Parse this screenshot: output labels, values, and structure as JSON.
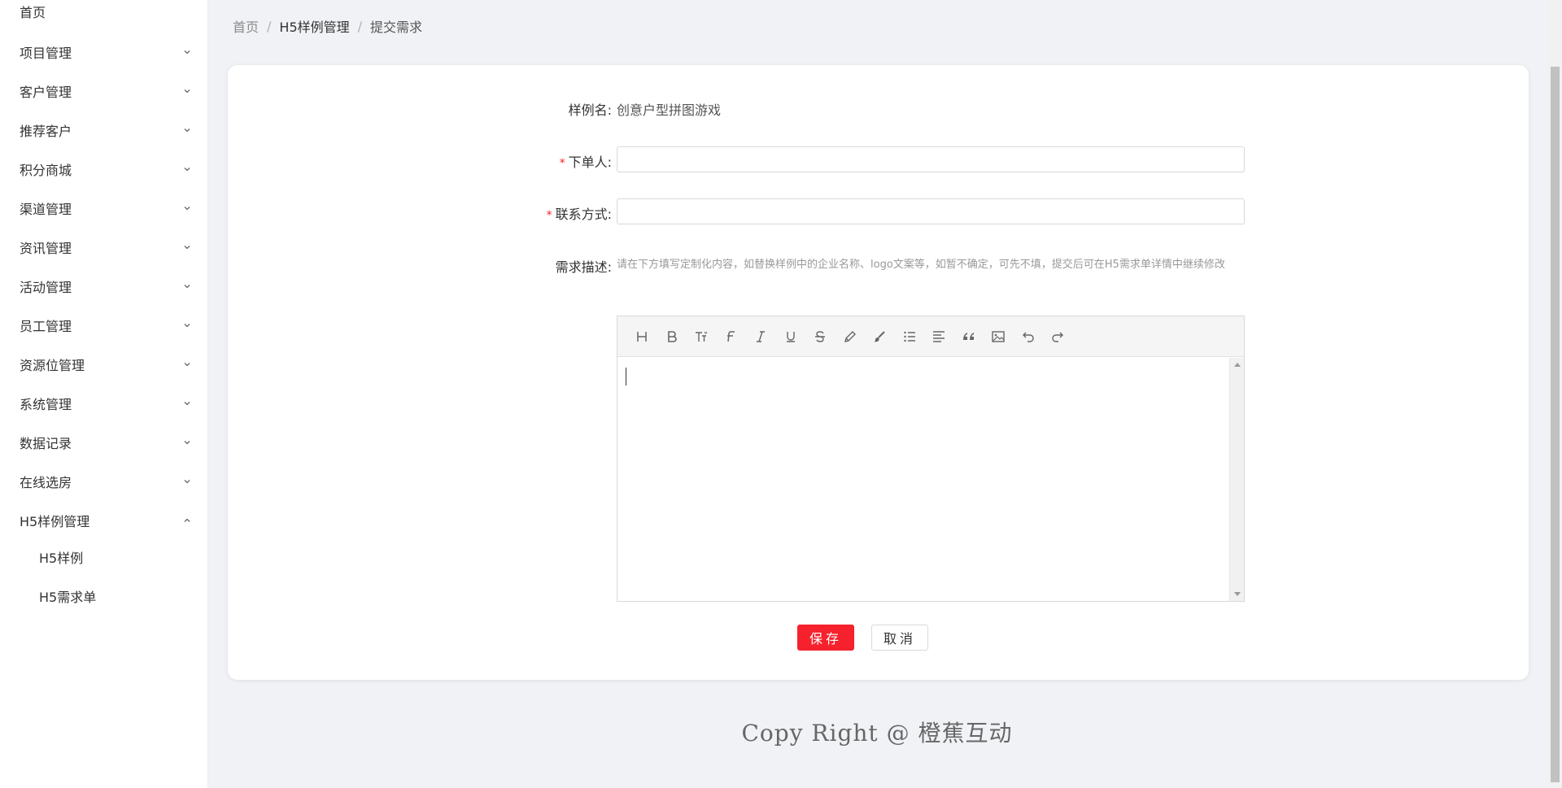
{
  "sidebar": {
    "home": "首页",
    "items": [
      {
        "label": "项目管理"
      },
      {
        "label": "客户管理"
      },
      {
        "label": "推荐客户"
      },
      {
        "label": "积分商城"
      },
      {
        "label": "渠道管理"
      },
      {
        "label": "资讯管理"
      },
      {
        "label": "活动管理"
      },
      {
        "label": "员工管理"
      },
      {
        "label": "资源位管理"
      },
      {
        "label": "系统管理"
      },
      {
        "label": "数据记录"
      },
      {
        "label": "在线选房"
      },
      {
        "label": "H5样例管理"
      }
    ],
    "sub_items": [
      {
        "label": "H5样例"
      },
      {
        "label": "H5需求单"
      }
    ]
  },
  "breadcrumb": {
    "home": "首页",
    "sep": "/",
    "section": "H5样例管理",
    "current": "提交需求"
  },
  "form": {
    "sample_name_label": "样例名:",
    "sample_name_value": "创意户型拼图游戏",
    "required_mark": "*",
    "orderer_label": "下单人:",
    "orderer_value": "",
    "contact_label": "联系方式:",
    "contact_value": "",
    "description_label": "需求描述:",
    "description_hint": "请在下方填写定制化内容，如替换样例中的企业名称、logo文案等，如暂不确定，可先不填，提交后可在H5需求单详情中继续修改"
  },
  "editor": {
    "tools": [
      "heading-icon",
      "bold-icon",
      "font-size-icon",
      "font-family-icon",
      "italic-icon",
      "underline-icon",
      "strikethrough-icon",
      "highlight-icon",
      "brush-icon",
      "list-icon",
      "align-icon",
      "quote-icon",
      "image-icon",
      "undo-icon",
      "redo-icon"
    ]
  },
  "buttons": {
    "save": "保存",
    "cancel": "取消"
  },
  "footer": {
    "text": "Copy Right @ 橙蕉互动"
  },
  "colors": {
    "accent": "#f5222d",
    "background": "#f0f2f5"
  }
}
